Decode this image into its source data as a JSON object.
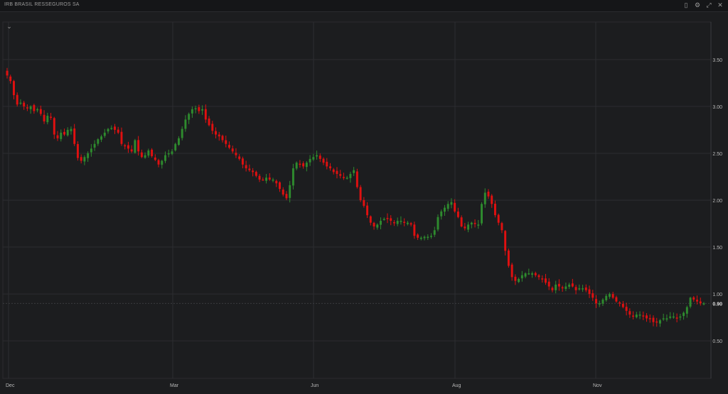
{
  "window": {
    "title": "IRB BRASIL RESSEGUROS SA",
    "buttons": [
      "window-icon",
      "settings-icon",
      "expand-icon",
      "close-icon"
    ]
  },
  "colors": {
    "up": "#2e8b2e",
    "down": "#e01010",
    "grid": "#2c2d30",
    "background": "#1c1d1f",
    "axis_text": "#b8b8b8"
  },
  "chart_data": {
    "type": "candlestick",
    "x_ticks": [
      "Dec",
      "Mar",
      "Jun",
      "Aug",
      "Nov"
    ],
    "y_ticks": [
      "3.50",
      "3.00",
      "2.50",
      "2.00",
      "1.50",
      "1.00",
      "0.50"
    ],
    "ylim": [
      0.1,
      3.9
    ],
    "last_price": "0.90",
    "grid": true,
    "closes": [
      3.33,
      3.27,
      3.12,
      3.02,
      3.04,
      3.0,
      2.98,
      3.0,
      2.95,
      2.97,
      2.92,
      2.84,
      2.9,
      2.88,
      2.7,
      2.66,
      2.72,
      2.7,
      2.75,
      2.76,
      2.6,
      2.45,
      2.42,
      2.46,
      2.5,
      2.55,
      2.6,
      2.65,
      2.68,
      2.72,
      2.76,
      2.77,
      2.75,
      2.72,
      2.6,
      2.58,
      2.55,
      2.52,
      2.64,
      2.52,
      2.46,
      2.48,
      2.53,
      2.47,
      2.43,
      2.38,
      2.42,
      2.48,
      2.5,
      2.52,
      2.6,
      2.66,
      2.76,
      2.86,
      2.92,
      2.97,
      2.98,
      2.95,
      2.97,
      2.86,
      2.8,
      2.74,
      2.7,
      2.68,
      2.64,
      2.6,
      2.56,
      2.52,
      2.48,
      2.44,
      2.38,
      2.34,
      2.32,
      2.3,
      2.26,
      2.22,
      2.22,
      2.24,
      2.22,
      2.22,
      2.18,
      2.12,
      2.06,
      2.02,
      2.16,
      2.34,
      2.4,
      2.38,
      2.36,
      2.4,
      2.44,
      2.46,
      2.48,
      2.44,
      2.4,
      2.36,
      2.34,
      2.3,
      2.28,
      2.26,
      2.24,
      2.24,
      2.28,
      2.32,
      2.14,
      2.0,
      1.94,
      1.84,
      1.76,
      1.72,
      1.74,
      1.78,
      1.8,
      1.8,
      1.78,
      1.76,
      1.78,
      1.78,
      1.76,
      1.76,
      1.74,
      1.62,
      1.6,
      1.6,
      1.61,
      1.61,
      1.62,
      1.68,
      1.82,
      1.88,
      1.92,
      1.96,
      1.98,
      1.88,
      1.82,
      1.72,
      1.7,
      1.74,
      1.76,
      1.75,
      1.74,
      1.96,
      2.08,
      2.04,
      1.96,
      1.84,
      1.76,
      1.68,
      1.46,
      1.3,
      1.18,
      1.14,
      1.16,
      1.2,
      1.22,
      1.22,
      1.22,
      1.2,
      1.18,
      1.16,
      1.12,
      1.08,
      1.04,
      1.1,
      1.08,
      1.06,
      1.08,
      1.1,
      1.08,
      1.04,
      1.06,
      1.06,
      1.04,
      1.0,
      0.96,
      0.9,
      0.9,
      0.94,
      0.98,
      1.0,
      0.96,
      0.92,
      0.9,
      0.86,
      0.82,
      0.78,
      0.76,
      0.78,
      0.78,
      0.76,
      0.74,
      0.74,
      0.7,
      0.7,
      0.72,
      0.74,
      0.74,
      0.76,
      0.76,
      0.74,
      0.76,
      0.8,
      0.86,
      0.96,
      0.94,
      0.92,
      0.9,
      0.9
    ]
  }
}
